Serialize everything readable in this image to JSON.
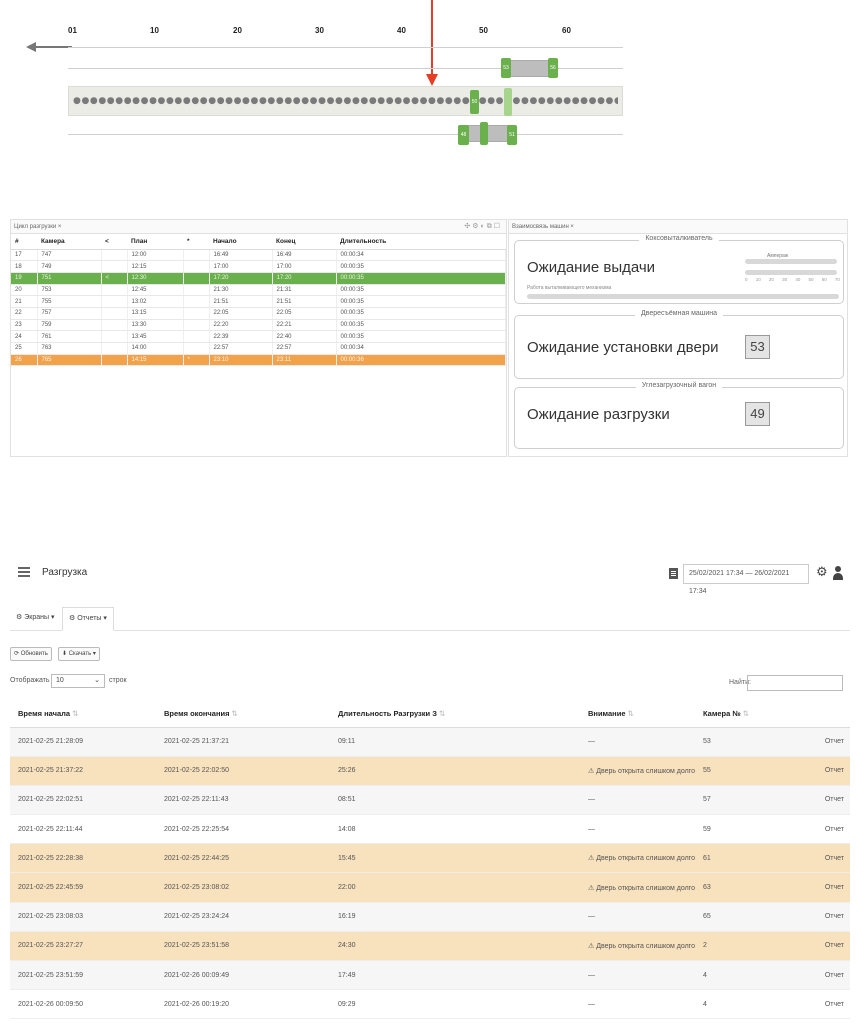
{
  "timeline": {
    "ticks": [
      "01",
      "10",
      "20",
      "30",
      "40",
      "50",
      "60"
    ],
    "upper_markers": [
      "53",
      "56"
    ],
    "main_marker": "50",
    "lower_markers": [
      "48",
      "51"
    ],
    "marker_color": "#6ab04c",
    "arrow_color": "#e53e25"
  },
  "cycle_panel": {
    "tab_label": "Цикл разгрузки ×",
    "columns": [
      "#",
      "Камера",
      "<",
      "План",
      "*",
      "Начало",
      "Конец",
      "Длительность"
    ],
    "rows": [
      [
        "17",
        "747",
        "",
        "12:00",
        "",
        "16:49",
        "16:49",
        "00:00:34"
      ],
      [
        "18",
        "749",
        "",
        "12:15",
        "",
        "17:00",
        "17:00",
        "00:00:35"
      ],
      [
        "19",
        "751",
        "<",
        "12:30",
        "",
        "17:20",
        "17:20",
        "00:00:35"
      ],
      [
        "20",
        "753",
        "",
        "12:45",
        "",
        "21:30",
        "21:31",
        "00:00:35"
      ],
      [
        "21",
        "755",
        "",
        "13:02",
        "",
        "21:51",
        "21:51",
        "00:00:35"
      ],
      [
        "22",
        "757",
        "",
        "13:15",
        "",
        "22:05",
        "22:05",
        "00:00:35"
      ],
      [
        "23",
        "759",
        "",
        "13:30",
        "",
        "22:20",
        "22:21",
        "00:00:35"
      ],
      [
        "24",
        "761",
        "",
        "13:45",
        "",
        "22:39",
        "22:40",
        "00:00:35"
      ],
      [
        "25",
        "763",
        "",
        "14:00",
        "",
        "22:57",
        "22:57",
        "00:00:34"
      ],
      [
        "26",
        "765",
        "",
        "14:15",
        "*",
        "23:10",
        "23:11",
        "00:00:36"
      ]
    ],
    "highlight_green_row": 2,
    "highlight_orange_row": 9,
    "green": "#6ab04c",
    "orange": "#f1a24b"
  },
  "interact_panel": {
    "tab_label": "Взаимосвязь машин ×",
    "coke_pusher": {
      "title": "Коксовыталкиватель",
      "status": "Ожидание выдачи",
      "sub": "Работа выталкивающего механизма",
      "gauge_label": "Ампераж",
      "gauge_ticks": [
        "0",
        "10",
        "20",
        "30",
        "40",
        "50",
        "60",
        "70"
      ]
    },
    "door_machine": {
      "title": "Двересъёмная машина",
      "status": "Ожидание установки двери",
      "number": "53"
    },
    "quench_car": {
      "title": "Углезагрузочный вагон",
      "status": "Ожидание разгрузки",
      "number": "49"
    }
  },
  "report": {
    "title": "Разгрузка",
    "date_range": "25/02/2021 17:34 — 26/02/2021 17:34",
    "tabs": [
      "Экраны ▾",
      "Отчеты ▾"
    ],
    "refresh_label": "Обновить",
    "download_label": "Скачать ▾",
    "show_label": "Отображать",
    "page_length": "10",
    "rows_label": "строк",
    "search_label": "Найти:",
    "columns": [
      "Время начала",
      "Время окончания",
      "Длительность Разгрузки З",
      "Внимание",
      "Камера №"
    ],
    "rows": [
      {
        "start": "2021-02-25 21:28:09",
        "end": "2021-02-25 21:37:21",
        "duration": "09:11",
        "attention": "—",
        "chamber": "53",
        "link": "Отчет",
        "warn": false
      },
      {
        "start": "2021-02-25 21:37:22",
        "end": "2021-02-25 22:02:50",
        "duration": "25:26",
        "attention": "⚠ Дверь открыта слишком долго",
        "chamber": "55",
        "link": "Отчет",
        "warn": true
      },
      {
        "start": "2021-02-25 22:02:51",
        "end": "2021-02-25 22:11:43",
        "duration": "08:51",
        "attention": "—",
        "chamber": "57",
        "link": "Отчет",
        "warn": false
      },
      {
        "start": "2021-02-25 22:11:44",
        "end": "2021-02-25 22:25:54",
        "duration": "14:08",
        "attention": "—",
        "chamber": "59",
        "link": "Отчет",
        "warn": false
      },
      {
        "start": "2021-02-25 22:28:38",
        "end": "2021-02-25 22:44:25",
        "duration": "15:45",
        "attention": "⚠ Дверь открыта слишком долго",
        "chamber": "61",
        "link": "Отчет",
        "warn": true
      },
      {
        "start": "2021-02-25 22:45:59",
        "end": "2021-02-25 23:08:02",
        "duration": "22:00",
        "attention": "⚠ Дверь открыта слишком долго",
        "chamber": "63",
        "link": "Отчет",
        "warn": true
      },
      {
        "start": "2021-02-25 23:08:03",
        "end": "2021-02-25 23:24:24",
        "duration": "16:19",
        "attention": "—",
        "chamber": "65",
        "link": "Отчет",
        "warn": false
      },
      {
        "start": "2021-02-25 23:27:27",
        "end": "2021-02-25 23:51:58",
        "duration": "24:30",
        "attention": "⚠ Дверь открыта слишком долго",
        "chamber": "2",
        "link": "Отчет",
        "warn": true
      },
      {
        "start": "2021-02-25 23:51:59",
        "end": "2021-02-26 00:09:49",
        "duration": "17:49",
        "attention": "—",
        "chamber": "4",
        "link": "Отчет",
        "warn": false
      },
      {
        "start": "2021-02-26 00:09:50",
        "end": "2021-02-26 00:19:20",
        "duration": "09:29",
        "attention": "—",
        "chamber": "4",
        "link": "Отчет",
        "warn": false
      }
    ],
    "warn_color": "#f8e1bd",
    "link_color": "#5a8fc7"
  }
}
